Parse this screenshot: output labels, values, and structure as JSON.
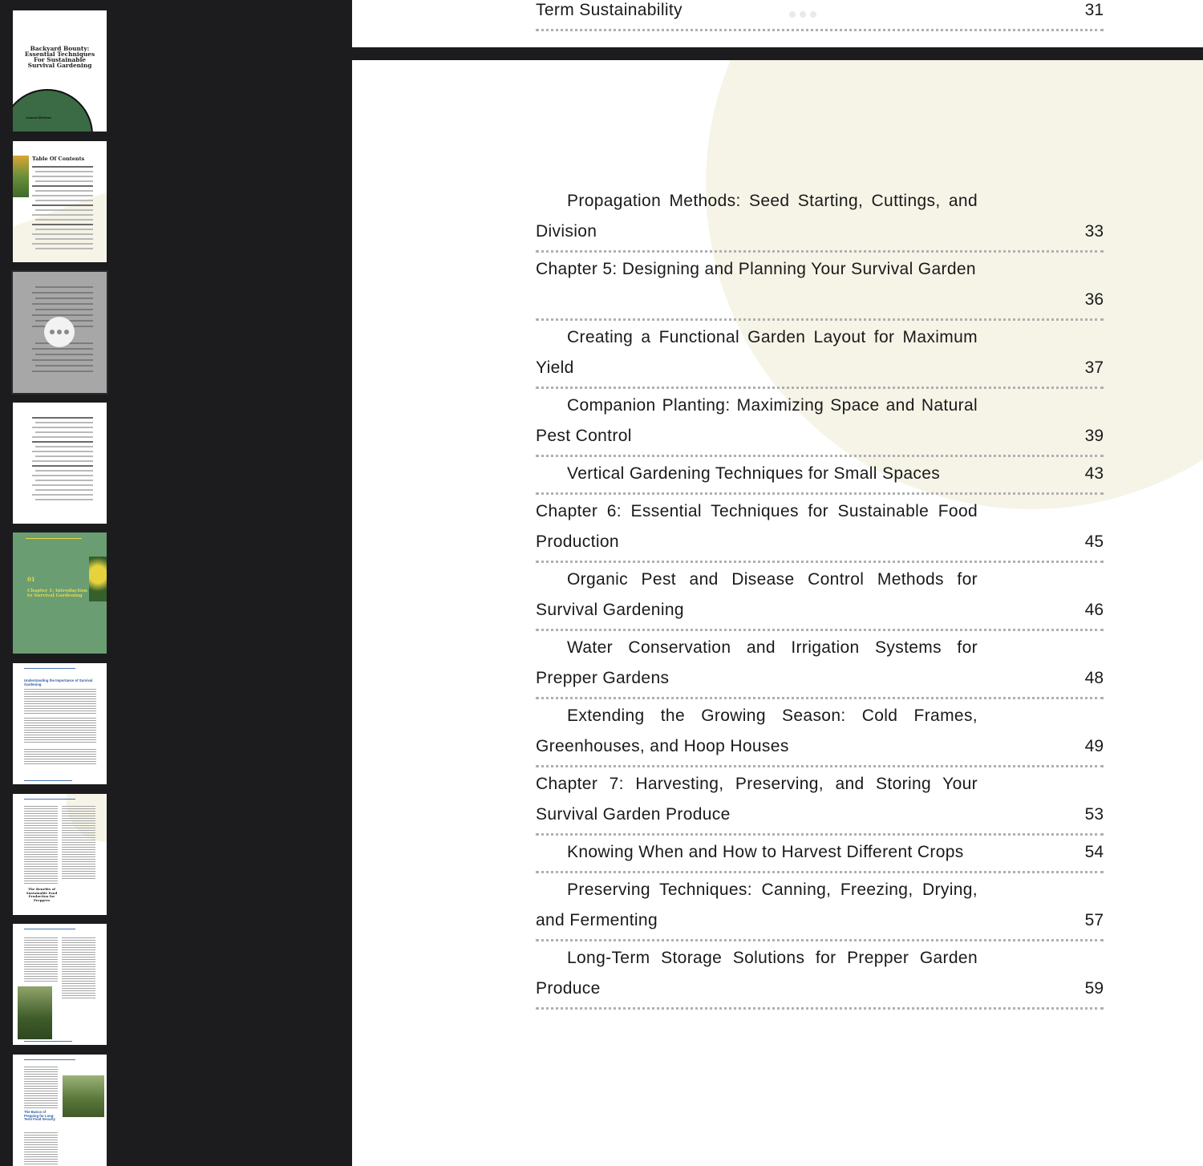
{
  "sidebar": {
    "thumbnails": [
      {
        "page": 1,
        "kind": "cover",
        "title": "Backyard Bounty: Essential Techniques For Sustainable Survival Gardening",
        "author": "Joanna Whitman"
      },
      {
        "page": 2,
        "kind": "toc",
        "title": "Table Of Contents"
      },
      {
        "page": 3,
        "kind": "toc-continued",
        "selected": true
      },
      {
        "page": 4,
        "kind": "toc-continued"
      },
      {
        "page": 5,
        "kind": "chapter-opener",
        "number": "01",
        "title": "Chapter 1: Introduction to Survival Gardening"
      },
      {
        "page": 6,
        "kind": "text",
        "heading": "Understanding the Importance of Survival Gardening"
      },
      {
        "page": 7,
        "kind": "text",
        "heading": "The Benefits of Sustainable Food Production for Preppers"
      },
      {
        "page": 8,
        "kind": "text-image"
      },
      {
        "page": 9,
        "kind": "text-image",
        "heading": "The Basics of Prepping for Long-Term Food Security"
      }
    ]
  },
  "viewer": {
    "previous_page_tail": {
      "text": "Term Sustainability",
      "page": "31"
    },
    "toc_entries": [
      {
        "text": "Propagation Methods: Seed Starting, Cuttings, and Division",
        "page": "33",
        "sub": true
      },
      {
        "text": "Chapter 5: Designing and Planning Your Survival Garden",
        "page": "36",
        "sub": false
      },
      {
        "text": "Creating a Functional Garden Layout for Maximum Yield",
        "page": "37",
        "sub": true
      },
      {
        "text": "Companion Planting: Maximizing Space and Natural Pest Control",
        "page": "39",
        "sub": true
      },
      {
        "text": "Vertical Gardening Techniques for Small Spaces",
        "page": "43",
        "sub": true
      },
      {
        "text": "Chapter 6: Essential Techniques for Sustainable Food Production",
        "page": "45",
        "sub": false
      },
      {
        "text": "Organic Pest and Disease Control Methods for Survival Gardening",
        "page": "46",
        "sub": true
      },
      {
        "text": "Water Conservation and Irrigation Systems for Prepper Gardens",
        "page": "48",
        "sub": true
      },
      {
        "text": "Extending the Growing Season: Cold Frames, Greenhouses, and Hoop Houses",
        "page": "49",
        "sub": true
      },
      {
        "text": "Chapter 7: Harvesting, Preserving, and Storing Your Survival Garden Produce",
        "page": "53",
        "sub": false
      },
      {
        "text": "Knowing When and How to Harvest Different Crops",
        "page": "54",
        "sub": true
      },
      {
        "text": "Preserving Techniques: Canning, Freezing, Drying, and Fermenting",
        "page": "57",
        "sub": true
      },
      {
        "text": "Long-Term Storage Solutions for Prepper Garden Produce",
        "page": "59",
        "sub": true
      }
    ]
  },
  "colors": {
    "sidebar_bg": "#1c1c1e",
    "page_circle": "#f6f4e7",
    "cover_green": "#3a6b45",
    "chapter_green": "#6a9d72",
    "chapter_yellow": "#e8d84a"
  }
}
